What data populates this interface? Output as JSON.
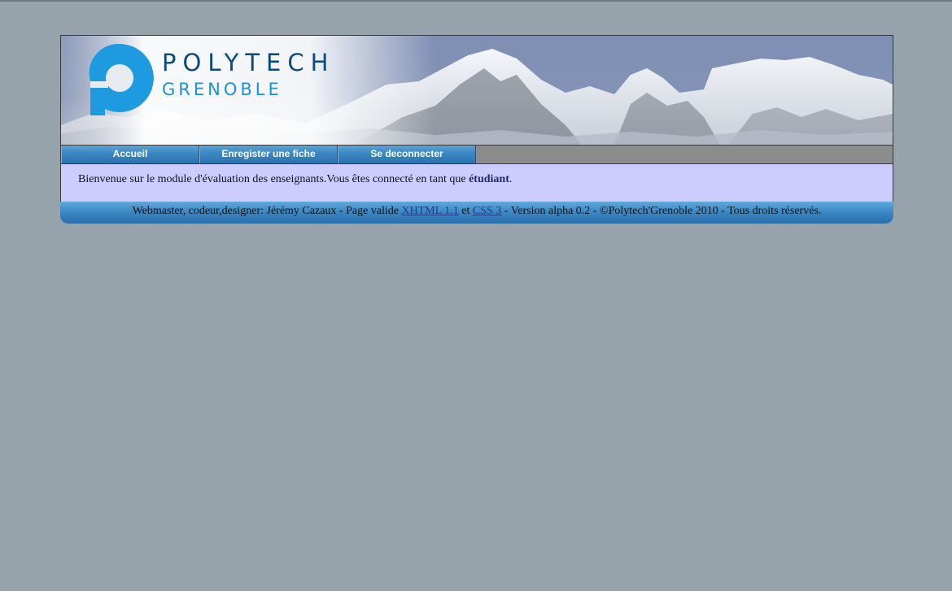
{
  "brand": {
    "name_top": "POLYTECH",
    "name_bottom": "GRENOBLE"
  },
  "nav": {
    "items": [
      {
        "label": "Accueil"
      },
      {
        "label": "Enregister une fiche"
      },
      {
        "label": "Se deconnecter"
      }
    ]
  },
  "main": {
    "welcome_text": "Bienvenue sur le module d'évaluation des enseignants.Vous êtes connecté en tant que ",
    "role": "étudiant",
    "welcome_end": "."
  },
  "footer": {
    "prefix": "Webmaster, codeur,designer: Jérémy Cazaux - Page valide ",
    "link1": "XHTML 1.1",
    "mid": " et ",
    "link2": "CSS 3",
    "suffix": " - Version alpha 0.2  - ©Polytech'Grenoble 2010 - Tous droits réservés."
  },
  "colors": {
    "background": "#97a3ab",
    "content_bg": "#cdccff",
    "nav_blue": "#3b87c2",
    "brand_dark": "#0b4a7d",
    "brand_light": "#1f8fd6"
  }
}
